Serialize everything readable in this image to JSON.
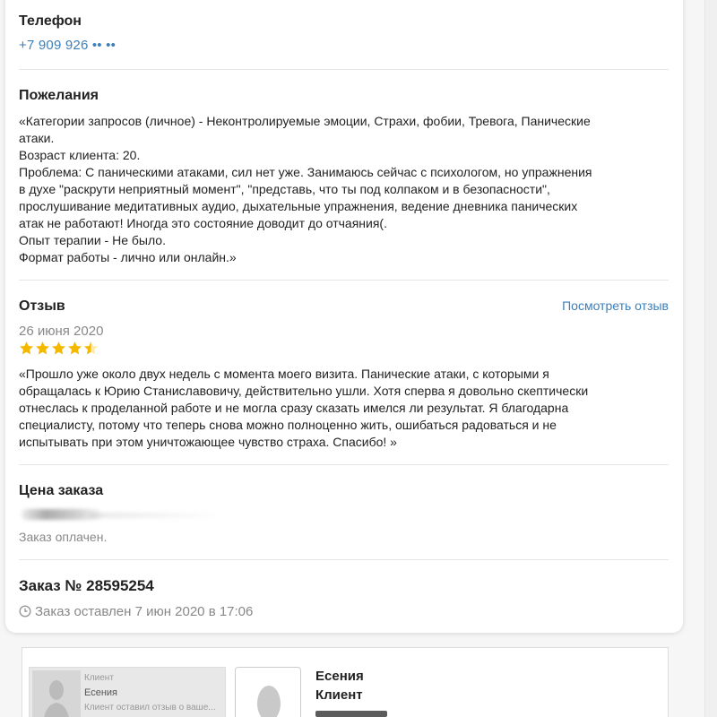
{
  "phone": {
    "heading": "Телефон",
    "value": "+7 909 926 •• ••"
  },
  "wishes": {
    "heading": "Пожелания",
    "text": "«Категории запросов (личное) - Неконтролируемые эмоции, Страхи, фобии, Тревога, Панические\nатаки.\nВозраст клиента: 20.\nПроблема: С паническими атаками, сил нет уже. Занимаюсь сейчас с психологом, но упражнения\nв духе \"раскрути неприятный момент\", \"представь, что ты под колпаком и в безопасности\",\nпрослушивание медитативных аудио, дыхательные упражнения, ведение дневника панических\nатак не работают! Иногда это состояние доводит до отчаяния(.\nОпыт терапии - Не было.\nФормат работы - лично или онлайн.»"
  },
  "review": {
    "heading": "Отзыв",
    "view_link": "Посмотреть отзыв",
    "date": "26 июня 2020",
    "rating": 4.5,
    "rating_max": 5,
    "star_color": "#f5b800",
    "text": "«Прошло уже около двух недель с момента моего визита. Панические атаки, с которыми я\nобращалась к Юрию Станиславовичу, действительно ушли. Хотя сперва я довольно скептически\nотнеслась к проделанной работе и не могла сразу сказать имелся ли результат. Я благодарна\nспециалисту, потому что теперь снова можно полноценно жить, ошибаться радоваться и не\nиспытывать при этом уничтожающее чувство страха. Спасибо! »"
  },
  "price": {
    "heading": "Цена заказа",
    "status": "Заказ оплачен."
  },
  "order": {
    "heading": "Заказ № 28595254",
    "placed": "Заказ оставлен 7 июн 2020 в 17:06"
  },
  "client_card": {
    "preview_role": "Клиент",
    "preview_name": "Есения",
    "preview_snippet": "Клиент оставил отзыв о ваше...",
    "name": "Есения",
    "role": "Клиент"
  },
  "colors": {
    "link": "#3d7fb8",
    "muted": "#888888",
    "accent_star": "#f5b800"
  }
}
